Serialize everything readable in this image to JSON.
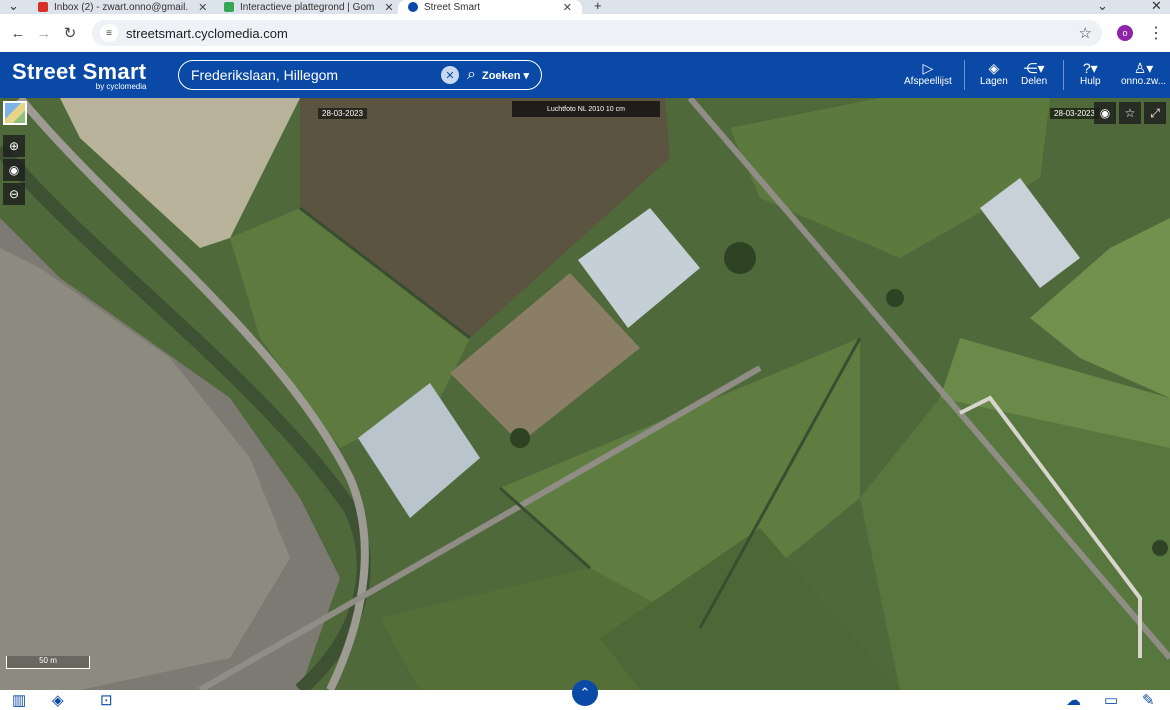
{
  "browser": {
    "tabs": [
      {
        "title": "Inbox (2) - zwart.onno@gmail.",
        "favicon_color": "#d93025"
      },
      {
        "title": "Interactieve plattegrond | Gom",
        "favicon_color": "#34a853"
      },
      {
        "title": "Street Smart",
        "favicon_color": "#0a4aa6"
      }
    ],
    "url": "streetsmart.cyclomedia.com",
    "profile_initial": "o"
  },
  "header": {
    "logo_main": "Street Smart",
    "logo_sub": "by cyclomedia",
    "search_value": "Frederikslaan, Hillegom",
    "search_button": "Zoeken",
    "buttons": {
      "playlist": "Afspeellijst",
      "layers": "Lagen",
      "share": "Delen",
      "help": "Hulp",
      "user": "onno.zw..."
    }
  },
  "map": {
    "source": "Luchtfoto NL 2010 10 cm",
    "date_left": "28-03-2023",
    "date_right": "28-03-2023",
    "scale": "50 m"
  },
  "colors": {
    "brand_blue": "#0a4aa6"
  }
}
